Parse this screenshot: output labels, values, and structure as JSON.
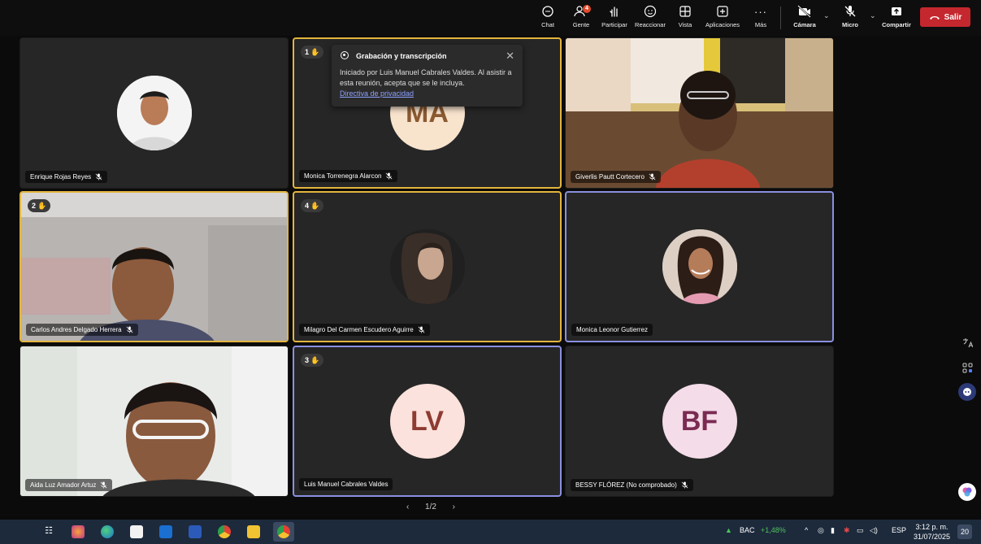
{
  "toolbar": {
    "chat": "Chat",
    "people": "Gente",
    "people_badge": "4",
    "raise": "Participar",
    "react": "Reaccionar",
    "view": "Vista",
    "apps": "Aplicaciones",
    "more": "Más",
    "camera": "Cámara",
    "mic": "Micro",
    "share": "Compartir",
    "leave": "Salir"
  },
  "popup": {
    "title": "Grabación y transcripción",
    "body": "Iniciado por Luis Manuel Cabrales Valdes. Al asistir a esta reunión, acepta que se le incluya.",
    "link": "Directiva de privacidad"
  },
  "tiles": [
    {
      "name": "Enrique Rojas Reyes"
    },
    {
      "name": "Monica Torrenegra Alarcon",
      "hand": "1",
      "initials": "MA"
    },
    {
      "name": "Giverlis Pautt Cortecero"
    },
    {
      "name": "Carlos Andres Delgado Herrera",
      "hand": "2"
    },
    {
      "name": "Milagro Del Carmen Escudero Aguirre",
      "hand": "4"
    },
    {
      "name": "Monica Leonor Gutierrez"
    },
    {
      "name": "Aida Luz Amador Artuz"
    },
    {
      "name": "Luis Manuel Cabrales Valdes",
      "hand": "3",
      "initials": "LV"
    },
    {
      "name": "BESSY FLÓREZ (No comprobado)",
      "initials": "BF"
    }
  ],
  "pager": {
    "label": "1/2"
  },
  "taskbar": {
    "stock_name": "BAC",
    "stock_change": "+1,48%",
    "lang": "ESP",
    "time": "3:12 p. m.",
    "date": "31/07/2025",
    "notif": "20"
  },
  "colors": {
    "raised": "#e3b53d",
    "speaking": "#8a8fe0",
    "leave": "#c4272e",
    "stock_up": "#4fc35a"
  }
}
